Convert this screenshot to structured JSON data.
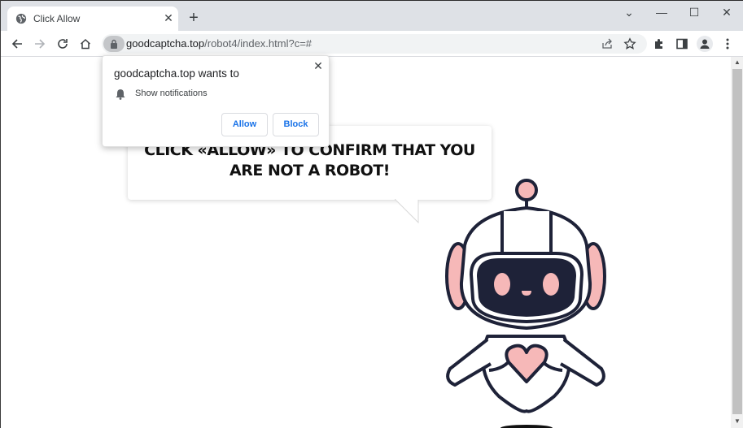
{
  "browser": {
    "tab": {
      "title": "Click Allow",
      "icon": "globe-icon",
      "close_icon": "close-icon"
    },
    "new_tab_icon": "plus-icon",
    "window_controls": {
      "tab_search": "⌄",
      "minimize": "—",
      "maximize": "☐",
      "close": "✕"
    },
    "address_bar": {
      "domain": "goodcaptcha.top",
      "path": "/robot4/index.html?c=#",
      "lock_icon": "lock-icon"
    },
    "toolbar_icons": [
      "back-icon",
      "forward-icon",
      "reload-icon",
      "home-icon",
      "share-icon",
      "star-icon",
      "extensions-icon",
      "side-panel-icon",
      "profile-icon",
      "menu-icon"
    ]
  },
  "permission_popup": {
    "title": "goodcaptcha.top wants to",
    "permission": "Show notifications",
    "allow_label": "Allow",
    "block_label": "Block",
    "close_symbol": "✕"
  },
  "page": {
    "message_line1": "CLICK «ALLOW» TO CONFIRM THAT YOU",
    "message_line2": "ARE NOT A ROBOT!",
    "robot_colors": {
      "outline": "#1e2238",
      "accent": "#f6b8b8",
      "face": "#1e2238"
    }
  },
  "scrollbar": {
    "up": "▲",
    "down": "▼"
  }
}
